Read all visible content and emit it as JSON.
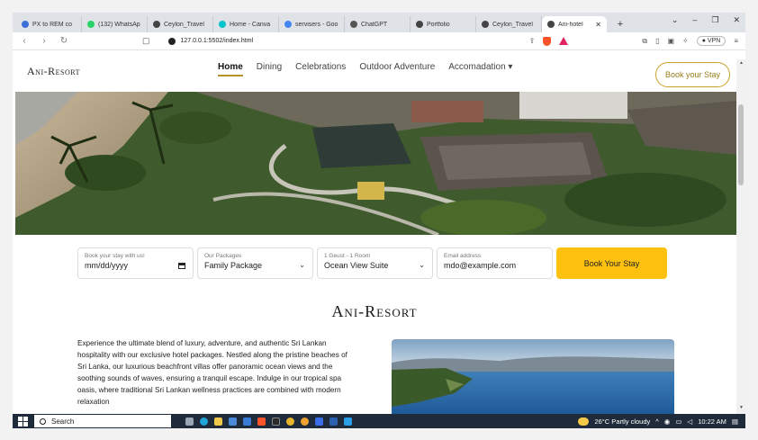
{
  "browser": {
    "tabs": [
      {
        "title": "PX to REM co",
        "color": "#3a6fd8"
      },
      {
        "title": "(132) WhatsAp",
        "color": "#25d366"
      },
      {
        "title": "Ceylon_Travel",
        "color": "#444444"
      },
      {
        "title": "Home - Canva",
        "color": "#00c4cc"
      },
      {
        "title": "servisers - Goo",
        "color": "#4285f4"
      },
      {
        "title": "ChatGPT",
        "color": "#555555"
      },
      {
        "title": "Portfolio",
        "color": "#444444"
      },
      {
        "title": "Ceylon_Travel",
        "color": "#444444"
      },
      {
        "title": "Ani-hotel",
        "color": "#444444",
        "active": true
      }
    ],
    "new_tab": "+",
    "url": "127.0.0.1:5502/index.html",
    "vpn_label": "VPN"
  },
  "site": {
    "logo": "Ani-Resort",
    "nav": [
      "Home",
      "Dining",
      "Celebrations",
      "Outdoor Adventure",
      "Accomadation ▾"
    ],
    "cta": "Book your Stay"
  },
  "booking": {
    "date_label": "Book your stay with us!",
    "date_value": "mm/dd/yyyy",
    "package_label": "Our Packages",
    "package_value": "Family Package",
    "guest_label": "1 Geust - 1 Room",
    "guest_value": "Ocean View Suite",
    "email_label": "Email address",
    "email_value": "mdo@example.com",
    "submit": "Book Your Stay"
  },
  "section": {
    "title": "Ani-Resort",
    "paragraph": "Experience the ultimate blend of luxury, adventure, and authentic Sri Lankan hospitality with our exclusive hotel packages. Nestled along the pristine beaches of Sri Lanka, our luxurious beachfront villas offer panoramic ocean views and the soothing sounds of waves, ensuring a tranquil escape. Indulge in our tropical spa oasis, where traditional Sri Lankan wellness practices are combined with modern relaxation"
  },
  "taskbar": {
    "search": "Search",
    "weather": "26°C  Partly cloudy",
    "time": "10:22 AM"
  }
}
